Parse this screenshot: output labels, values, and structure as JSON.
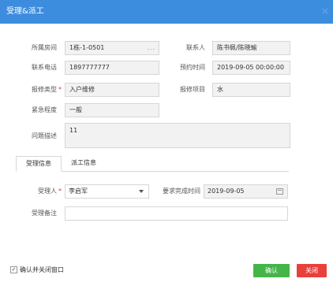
{
  "window": {
    "title": "受理&派工",
    "close_glyph": "×"
  },
  "form": {
    "room": {
      "label": "所属房间",
      "value": "1栋-1-0501",
      "picker_glyph": "..."
    },
    "contact": {
      "label": "联系人",
      "value": "陈书佩/陈晓瑜"
    },
    "phone": {
      "label": "联系电话",
      "value": "1897777777"
    },
    "appointment": {
      "label": "预约时间",
      "value": "2019-09-05 00:00:00"
    },
    "repair_type": {
      "label": "报修类型",
      "required_mark": "*",
      "value": "入户维修"
    },
    "repair_item": {
      "label": "报修项目",
      "value": "水"
    },
    "urgency": {
      "label": "紧急程度",
      "value": "一般"
    },
    "description": {
      "label": "问题描述",
      "value": "11"
    }
  },
  "tabs": [
    {
      "label": "受理信息",
      "active": true
    },
    {
      "label": "派工信息",
      "active": false
    }
  ],
  "accept": {
    "handler": {
      "label": "受理人",
      "required_mark": "*",
      "value": "李启军"
    },
    "deadline": {
      "label": "要求完成时间",
      "value": "2019-09-05"
    },
    "remark": {
      "label": "受理备注",
      "value": ""
    }
  },
  "footer": {
    "confirm_close_label": "确认并关闭窗口",
    "confirm_close_checked": true,
    "check_glyph": "✓",
    "ok_label": "确认",
    "close_label": "关闭"
  },
  "colors": {
    "titlebar": "#3c8dde",
    "ok_button": "#44b549",
    "close_button": "#e8403b",
    "required": "#e8322d"
  }
}
